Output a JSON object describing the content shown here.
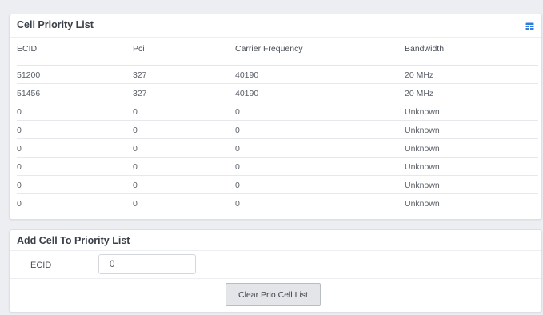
{
  "priority_panel": {
    "title": "Cell Priority List",
    "columns": [
      "ECID",
      "Pci",
      "Carrier Frequency",
      "Bandwidth"
    ],
    "rows": [
      [
        "51200",
        "327",
        "40190",
        "20 MHz"
      ],
      [
        "51456",
        "327",
        "40190",
        "20 MHz"
      ],
      [
        "0",
        "0",
        "0",
        "Unknown"
      ],
      [
        "0",
        "0",
        "0",
        "Unknown"
      ],
      [
        "0",
        "0",
        "0",
        "Unknown"
      ],
      [
        "0",
        "0",
        "0",
        "Unknown"
      ],
      [
        "0",
        "0",
        "0",
        "Unknown"
      ],
      [
        "0",
        "0",
        "0",
        "Unknown"
      ]
    ],
    "header_icon": "table-icon"
  },
  "add_panel": {
    "title": "Add Cell To Priority List",
    "ecid_label": "ECID",
    "ecid_value": "0",
    "clear_button_label": "Clear Prio Cell List"
  },
  "colors": {
    "background": "#eceef2",
    "panel": "#ffffff",
    "icon_accent": "#2f7de1",
    "button_bg": "#e3e5e8"
  }
}
